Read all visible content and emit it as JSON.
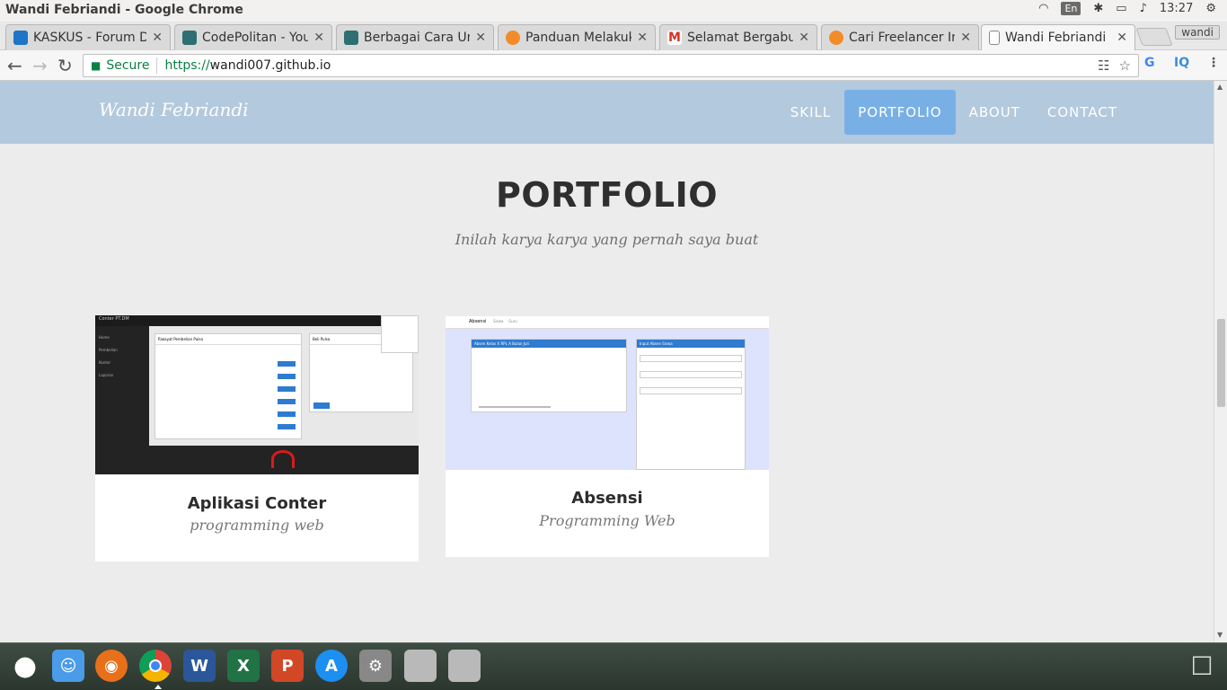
{
  "os": {
    "window_title": "Wandi Febriandi - Google Chrome",
    "lang": "En",
    "time": "13:27"
  },
  "browser": {
    "tabs": [
      {
        "label": "KASKUS - Forum D",
        "color": "#1e74c6"
      },
      {
        "label": "CodePolitan - You",
        "color": "#2d6f73"
      },
      {
        "label": "Berbagai Cara Un",
        "color": "#2d6f73"
      },
      {
        "label": "Panduan Melakuk",
        "color": "#f28c28"
      },
      {
        "label": "Selamat Bergabu",
        "color": "#d93025"
      },
      {
        "label": "Cari Freelancer In",
        "color": "#f28c28"
      },
      {
        "label": "Wandi Febriandi",
        "color": "#888888"
      }
    ],
    "profile": "wandi",
    "secure_label": "Secure",
    "url_scheme": "https://",
    "url_rest": "wandi007.github.io"
  },
  "site": {
    "brand": "Wandi Febriandi",
    "menu": [
      "SKILL",
      "PORTFOLIO",
      "ABOUT",
      "CONTACT"
    ],
    "active_menu": "PORTFOLIO",
    "section_title": "PORTFOLIO",
    "section_subtitle": "Inilah karya karya yang pernah saya buat",
    "cards": [
      {
        "title": "Aplikasi Conter",
        "subtitle": "programming web",
        "thumb": {
          "app_name": "Conter PT.DM",
          "panel_title": "Riwayat Pembelian Pulsa",
          "form_title": "Beli Pulsa",
          "menu": [
            "Home",
            "Pembelian",
            "Konter",
            "Laporan"
          ]
        }
      },
      {
        "title": "Absensi",
        "subtitle": "Programming Web",
        "thumb": {
          "app_name": "Absensi",
          "nav": [
            "Siswa",
            "Guru"
          ],
          "panel_title": "Absen Kelas X RPL A Bulan Juli",
          "form_title": "Input Absen Siswa"
        }
      }
    ]
  }
}
